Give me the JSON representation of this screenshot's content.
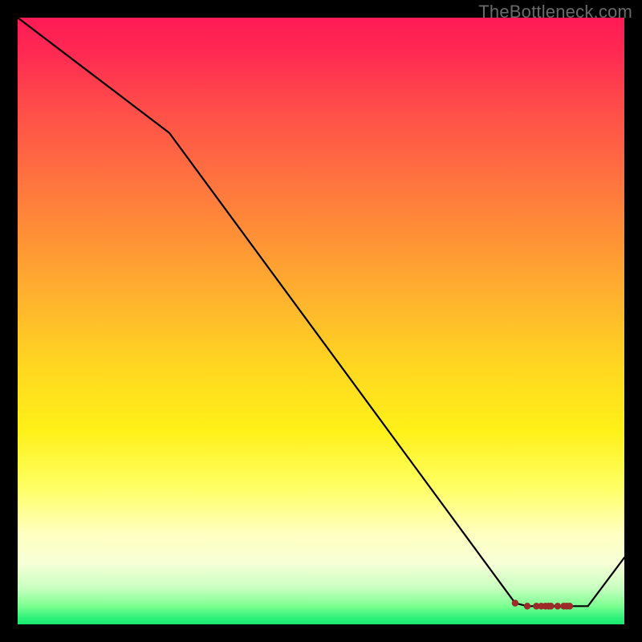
{
  "watermark": "TheBottleneck.com",
  "chart_data": {
    "type": "line",
    "title": "",
    "xlabel": "",
    "ylabel": "",
    "xlim": [
      0,
      100
    ],
    "ylim": [
      0,
      100
    ],
    "x": [
      0,
      25,
      82,
      84,
      85.5,
      86.3,
      87,
      87.5,
      87.9,
      89,
      90,
      90.5,
      91,
      94,
      100
    ],
    "values": [
      100,
      81,
      3.5,
      3,
      3,
      3,
      3,
      3,
      3,
      3,
      3,
      3,
      3,
      3,
      11
    ],
    "series_name": "curve",
    "markers": {
      "x": [
        82,
        84,
        85.5,
        86.3,
        87,
        87.5,
        87.9,
        89,
        90,
        90.5,
        91
      ],
      "y": [
        3.5,
        3,
        3,
        3,
        3,
        3,
        3,
        3,
        3,
        3,
        3
      ]
    },
    "grid": false,
    "legend_position": "none"
  }
}
